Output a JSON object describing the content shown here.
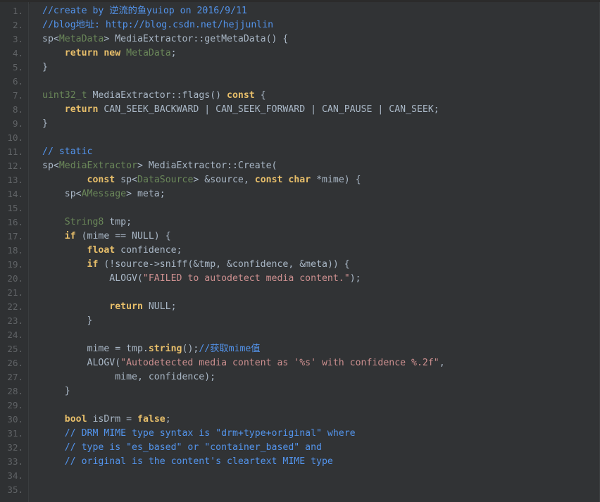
{
  "editor": {
    "name": "code-viewer",
    "language": "cpp",
    "theme": "darcula",
    "colors": {
      "background": "#313335",
      "gutter_background": "#2f3133",
      "line_number": "#606366",
      "plain_text": "#a9b7c6",
      "keyword": "#cc7832",
      "keyword_gold": "#e8bf6a",
      "type_green": "#6a8759",
      "string": "#cc8f8f",
      "line_comment": "#5394ec",
      "top_strip": "#2b2b2b"
    },
    "first_line_number": 1,
    "last_line_number": 35,
    "total_lines": 35
  },
  "lines": [
    {
      "number": "1.",
      "tokens": [
        {
          "text": "//create by ",
          "cls": "t-linecmt"
        },
        {
          "text": "逆流的鱼",
          "cls": "t-linecmt"
        },
        {
          "text": "yuiop on 2016/9/11",
          "cls": "t-linecmt"
        }
      ],
      "plain": "//create by 逆流的鱼yuiop on 2016/9/11"
    },
    {
      "number": "2.",
      "tokens": [
        {
          "text": "//blog",
          "cls": "t-linecmt"
        },
        {
          "text": "地址",
          "cls": "t-linecmt"
        },
        {
          "text": ": http://blog.csdn.net/hejjunlin",
          "cls": "t-linecmt"
        }
      ],
      "plain": "//blog地址: http://blog.csdn.net/hejjunlin"
    },
    {
      "number": "3.",
      "tokens": [
        {
          "text": "sp<",
          "cls": "t-plain"
        },
        {
          "text": "MetaData",
          "cls": "t-green"
        },
        {
          "text": "> MediaExtractor::getMetaData() {",
          "cls": "t-plain"
        }
      ],
      "plain": "sp<MetaData> MediaExtractor::getMetaData() {"
    },
    {
      "number": "4.",
      "tokens": [
        {
          "text": "    ",
          "cls": "t-plain"
        },
        {
          "text": "return new",
          "cls": "t-kw2 b"
        },
        {
          "text": " ",
          "cls": "t-plain"
        },
        {
          "text": "MetaData",
          "cls": "t-green"
        },
        {
          "text": ";",
          "cls": "t-plain"
        }
      ],
      "plain": "    return new MetaData;"
    },
    {
      "number": "5.",
      "tokens": [
        {
          "text": "}",
          "cls": "t-plain"
        }
      ],
      "plain": "}"
    },
    {
      "number": "6.",
      "tokens": [
        {
          "text": "",
          "cls": "t-plain"
        }
      ],
      "plain": ""
    },
    {
      "number": "7.",
      "tokens": [
        {
          "text": "uint32_t",
          "cls": "t-green"
        },
        {
          "text": " MediaExtractor::flags() ",
          "cls": "t-plain"
        },
        {
          "text": "const",
          "cls": "t-kw2 b"
        },
        {
          "text": " {",
          "cls": "t-plain"
        }
      ],
      "plain": "uint32_t MediaExtractor::flags() const {"
    },
    {
      "number": "8.",
      "tokens": [
        {
          "text": "    ",
          "cls": "t-plain"
        },
        {
          "text": "return",
          "cls": "t-kw2 b"
        },
        {
          "text": " CAN_SEEK_BACKWARD | CAN_SEEK_FORWARD | CAN_PAUSE | CAN_SEEK;",
          "cls": "t-plain"
        }
      ],
      "plain": "    return CAN_SEEK_BACKWARD | CAN_SEEK_FORWARD | CAN_PAUSE | CAN_SEEK;"
    },
    {
      "number": "9.",
      "tokens": [
        {
          "text": "}",
          "cls": "t-plain"
        }
      ],
      "plain": "}"
    },
    {
      "number": "10.",
      "tokens": [
        {
          "text": "",
          "cls": "t-plain"
        }
      ],
      "plain": ""
    },
    {
      "number": "11.",
      "tokens": [
        {
          "text": "// static",
          "cls": "t-linecmt"
        }
      ],
      "plain": "// static"
    },
    {
      "number": "12.",
      "tokens": [
        {
          "text": "sp<",
          "cls": "t-plain"
        },
        {
          "text": "MediaExtractor",
          "cls": "t-green"
        },
        {
          "text": "> MediaExtractor::Create(",
          "cls": "t-plain"
        }
      ],
      "plain": "sp<MediaExtractor> MediaExtractor::Create("
    },
    {
      "number": "13.",
      "tokens": [
        {
          "text": "        ",
          "cls": "t-plain"
        },
        {
          "text": "const",
          "cls": "t-kw2 b"
        },
        {
          "text": " sp<",
          "cls": "t-plain"
        },
        {
          "text": "DataSource",
          "cls": "t-green"
        },
        {
          "text": "> &source, ",
          "cls": "t-plain"
        },
        {
          "text": "const char",
          "cls": "t-kw2 b"
        },
        {
          "text": " *mime) {",
          "cls": "t-plain"
        }
      ],
      "plain": "        const sp<DataSource> &source, const char *mime) {"
    },
    {
      "number": "14.",
      "tokens": [
        {
          "text": "    sp<",
          "cls": "t-plain"
        },
        {
          "text": "AMessage",
          "cls": "t-green"
        },
        {
          "text": "> meta;",
          "cls": "t-plain"
        }
      ],
      "plain": "    sp<AMessage> meta;"
    },
    {
      "number": "15.",
      "tokens": [
        {
          "text": "",
          "cls": "t-plain"
        }
      ],
      "plain": ""
    },
    {
      "number": "16.",
      "tokens": [
        {
          "text": "    ",
          "cls": "t-plain"
        },
        {
          "text": "String8",
          "cls": "t-green"
        },
        {
          "text": " tmp;",
          "cls": "t-plain"
        }
      ],
      "plain": "    String8 tmp;"
    },
    {
      "number": "17.",
      "tokens": [
        {
          "text": "    ",
          "cls": "t-plain"
        },
        {
          "text": "if",
          "cls": "t-kw2 b"
        },
        {
          "text": " (mime == NULL) {",
          "cls": "t-plain"
        }
      ],
      "plain": "    if (mime == NULL) {"
    },
    {
      "number": "18.",
      "tokens": [
        {
          "text": "        ",
          "cls": "t-plain"
        },
        {
          "text": "float",
          "cls": "t-kw2 b"
        },
        {
          "text": " confidence;",
          "cls": "t-plain"
        }
      ],
      "plain": "        float confidence;"
    },
    {
      "number": "19.",
      "tokens": [
        {
          "text": "        ",
          "cls": "t-plain"
        },
        {
          "text": "if",
          "cls": "t-kw2 b"
        },
        {
          "text": " (!source->sniff(&tmp, &confidence, &meta)) {",
          "cls": "t-plain"
        }
      ],
      "plain": "        if (!source->sniff(&tmp, &confidence, &meta)) {"
    },
    {
      "number": "20.",
      "tokens": [
        {
          "text": "            ALOGV(",
          "cls": "t-plain"
        },
        {
          "text": "\"FAILED to autodetect media content.\"",
          "cls": "t-str"
        },
        {
          "text": ");",
          "cls": "t-plain"
        }
      ],
      "plain": "            ALOGV(\"FAILED to autodetect media content.\");"
    },
    {
      "number": "21.",
      "tokens": [
        {
          "text": "",
          "cls": "t-plain"
        }
      ],
      "plain": ""
    },
    {
      "number": "22.",
      "tokens": [
        {
          "text": "            ",
          "cls": "t-plain"
        },
        {
          "text": "return",
          "cls": "t-kw2 b"
        },
        {
          "text": " NULL;",
          "cls": "t-plain"
        }
      ],
      "plain": "            return NULL;"
    },
    {
      "number": "23.",
      "tokens": [
        {
          "text": "        }",
          "cls": "t-plain"
        }
      ],
      "plain": "        }"
    },
    {
      "number": "24.",
      "tokens": [
        {
          "text": "",
          "cls": "t-plain"
        }
      ],
      "plain": ""
    },
    {
      "number": "25.",
      "tokens": [
        {
          "text": "        mime = tmp.",
          "cls": "t-plain"
        },
        {
          "text": "string",
          "cls": "t-kw2 b"
        },
        {
          "text": "();",
          "cls": "t-plain"
        },
        {
          "text": "//获取mime值",
          "cls": "t-linecmt"
        }
      ],
      "plain": "        mime = tmp.string();//获取mime值"
    },
    {
      "number": "26.",
      "tokens": [
        {
          "text": "        ALOGV(",
          "cls": "t-plain"
        },
        {
          "text": "\"Autodetected media content as '%s' with confidence %.2f\"",
          "cls": "t-str"
        },
        {
          "text": ",",
          "cls": "t-plain"
        }
      ],
      "plain": "        ALOGV(\"Autodetected media content as '%s' with confidence %.2f\","
    },
    {
      "number": "27.",
      "tokens": [
        {
          "text": "             mime, confidence);",
          "cls": "t-plain"
        }
      ],
      "plain": "             mime, confidence);"
    },
    {
      "number": "28.",
      "tokens": [
        {
          "text": "    }",
          "cls": "t-plain"
        }
      ],
      "plain": "    }"
    },
    {
      "number": "29.",
      "tokens": [
        {
          "text": "",
          "cls": "t-plain"
        }
      ],
      "plain": ""
    },
    {
      "number": "30.",
      "tokens": [
        {
          "text": "    ",
          "cls": "t-plain"
        },
        {
          "text": "bool",
          "cls": "t-kw2 b"
        },
        {
          "text": " isDrm = ",
          "cls": "t-plain"
        },
        {
          "text": "false",
          "cls": "t-kw2 b"
        },
        {
          "text": ";",
          "cls": "t-plain"
        }
      ],
      "plain": "    bool isDrm = false;"
    },
    {
      "number": "31.",
      "tokens": [
        {
          "text": "    // DRM MIME type syntax is \"drm+type+original\" where",
          "cls": "t-linecmt"
        }
      ],
      "plain": "    // DRM MIME type syntax is \"drm+type+original\" where"
    },
    {
      "number": "32.",
      "tokens": [
        {
          "text": "    // type is \"es_based\" or \"container_based\" and",
          "cls": "t-linecmt"
        }
      ],
      "plain": "    // type is \"es_based\" or \"container_based\" and"
    },
    {
      "number": "33.",
      "tokens": [
        {
          "text": "    // original is the content's cleartext MIME type",
          "cls": "t-linecmt"
        }
      ],
      "plain": "    // original is the content's cleartext MIME type"
    },
    {
      "number": "34.",
      "tokens": [
        {
          "text": "",
          "cls": "t-plain"
        }
      ],
      "plain": ""
    },
    {
      "number": "35.",
      "tokens": [
        {
          "text": "",
          "cls": "t-plain"
        }
      ],
      "plain": ""
    }
  ]
}
